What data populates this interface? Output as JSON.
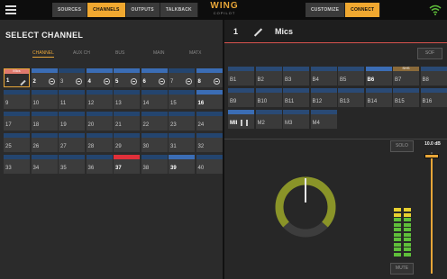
{
  "app": {
    "logo": "WING",
    "logo_sub": "COPILOT"
  },
  "toolbar": {
    "tabs": [
      {
        "label": "SOURCES",
        "active": false
      },
      {
        "label": "CHANNELS",
        "active": true
      },
      {
        "label": "OUTPUTS",
        "active": false
      },
      {
        "label": "TALKBACK",
        "active": false
      }
    ],
    "right_tabs": [
      {
        "label": "CUSTOMIZE",
        "active": false
      },
      {
        "label": "CONNECT",
        "active": true
      }
    ]
  },
  "left": {
    "title": "SELECT CHANNEL",
    "tabs": [
      {
        "label": "CHANNEL",
        "active": true
      },
      {
        "label": "AUX CH",
        "active": false
      },
      {
        "label": "BUS",
        "active": false
      },
      {
        "label": "MAIN",
        "active": false
      },
      {
        "label": "MATX",
        "active": false
      }
    ],
    "channels": [
      {
        "num": "1",
        "strip": "#e07a6e",
        "label": "Mics",
        "selected": true,
        "icon": "pencil",
        "bold": true
      },
      {
        "num": "2",
        "strip": "#3b6db5",
        "icon": "mic",
        "bold": true
      },
      {
        "num": "3",
        "strip": "#24456f",
        "icon": "mic"
      },
      {
        "num": "4",
        "strip": "#3b6db5",
        "icon": "mic",
        "bold": true
      },
      {
        "num": "5",
        "strip": "#3b6db5",
        "icon": "mic",
        "bold": true
      },
      {
        "num": "6",
        "strip": "#3b6db5",
        "icon": "mic",
        "bold": true
      },
      {
        "num": "7",
        "strip": "#24456f",
        "icon": "mic"
      },
      {
        "num": "8",
        "strip": "#3b6db5",
        "icon": "mic",
        "bold": true
      },
      {
        "num": "9",
        "strip": "#24456f"
      },
      {
        "num": "10",
        "strip": "#24456f"
      },
      {
        "num": "11",
        "strip": "#24456f"
      },
      {
        "num": "12",
        "strip": "#24456f"
      },
      {
        "num": "13",
        "strip": "#24456f"
      },
      {
        "num": "14",
        "strip": "#24456f"
      },
      {
        "num": "15",
        "strip": "#24456f"
      },
      {
        "num": "16",
        "strip": "#3b6db5",
        "bold": true
      },
      {
        "num": "17",
        "strip": "#24456f"
      },
      {
        "num": "18",
        "strip": "#24456f"
      },
      {
        "num": "19",
        "strip": "#24456f"
      },
      {
        "num": "20",
        "strip": "#24456f"
      },
      {
        "num": "21",
        "strip": "#24456f"
      },
      {
        "num": "22",
        "strip": "#24456f"
      },
      {
        "num": "23",
        "strip": "#24456f"
      },
      {
        "num": "24",
        "strip": "#24456f"
      },
      {
        "num": "25",
        "strip": "#24456f"
      },
      {
        "num": "26",
        "strip": "#24456f"
      },
      {
        "num": "27",
        "strip": "#24456f"
      },
      {
        "num": "28",
        "strip": "#24456f"
      },
      {
        "num": "29",
        "strip": "#24456f"
      },
      {
        "num": "30",
        "strip": "#24456f"
      },
      {
        "num": "31",
        "strip": "#24456f"
      },
      {
        "num": "32",
        "strip": "#24456f"
      },
      {
        "num": "33",
        "strip": "#24456f"
      },
      {
        "num": "34",
        "strip": "#24456f"
      },
      {
        "num": "35",
        "strip": "#24456f"
      },
      {
        "num": "36",
        "strip": "#24456f"
      },
      {
        "num": "37",
        "strip": "#e0303a",
        "bold": true
      },
      {
        "num": "38",
        "strip": "#24456f"
      },
      {
        "num": "39",
        "strip": "#3b6db5",
        "bold": true
      },
      {
        "num": "40",
        "strip": "#24456f"
      }
    ]
  },
  "right": {
    "channel_num": "1",
    "channel_name": "Mics",
    "sof_label": "SOF",
    "buses": [
      {
        "num": "B1"
      },
      {
        "num": "B2"
      },
      {
        "num": "B3"
      },
      {
        "num": "B4"
      },
      {
        "num": "B5"
      },
      {
        "num": "B6",
        "bold": true,
        "strip": "#3b6db5"
      },
      {
        "num": "B7",
        "label": "SHS",
        "strip": "#8a6a3a"
      },
      {
        "num": "B8"
      },
      {
        "num": "B9"
      },
      {
        "num": "B10"
      },
      {
        "num": "B11"
      },
      {
        "num": "B12"
      },
      {
        "num": "B13"
      },
      {
        "num": "B14"
      },
      {
        "num": "B15"
      },
      {
        "num": "B16"
      },
      {
        "num": "MII",
        "bold": true,
        "strip": "#3b6db5",
        "icon": "split"
      },
      {
        "num": "M2"
      },
      {
        "num": "M3"
      },
      {
        "num": "M4"
      }
    ],
    "solo_label": "SOLO",
    "mute_label": "MUTE",
    "fader_value": "10.0 dB",
    "fader_level": 0.97,
    "pan_position": 0.0,
    "meter_level_left": 0.62,
    "meter_level_right": 0.62,
    "colors": {
      "accent": "#e8a638",
      "bus_strip": "#2a4a75",
      "knob_ring": "#8a9428",
      "meter_green": "#5fbf3a",
      "meter_yellow": "#e8d030",
      "selection_header": "#d9534f"
    }
  }
}
